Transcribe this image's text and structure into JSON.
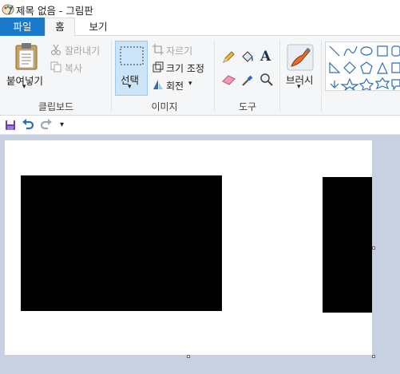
{
  "window": {
    "title": "제목 없음 - 그림판"
  },
  "tabs": {
    "file": "파일",
    "home": "홈",
    "view": "보기"
  },
  "clipboard": {
    "paste_label": "붙여넣기",
    "cut_label": "잘라내기",
    "copy_label": "복사",
    "group_label": "클립보드"
  },
  "image": {
    "select_label": "선택",
    "crop_label": "자르기",
    "resize_label": "크기 조정",
    "rotate_label": "회전",
    "group_label": "이미지"
  },
  "tools": {
    "group_label": "도구"
  },
  "brushes": {
    "label": "브러시"
  },
  "colors": {
    "accent": "#1979ca",
    "ribbon_bg": "#f5f6f7",
    "workspace_bg": "#c8d1e1",
    "shape_blue": "#2a6fb8",
    "select_highlight": "#cce4f7"
  }
}
